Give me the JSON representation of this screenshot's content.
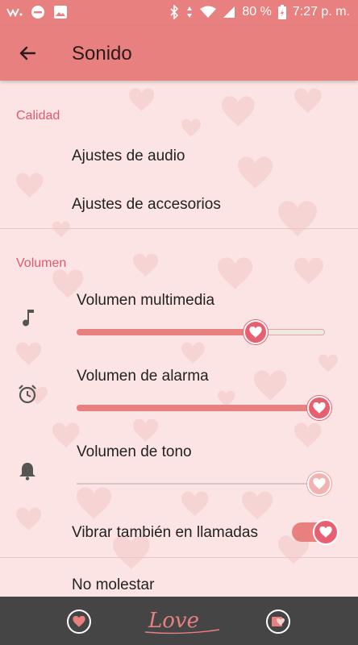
{
  "status_bar": {
    "battery_percent": "80 %",
    "time": "7:27 p. m."
  },
  "app_bar": {
    "title": "Sonido"
  },
  "sections": {
    "calidad": {
      "header": "Calidad",
      "items": [
        "Ajustes de audio",
        "Ajustes de accesorios"
      ]
    },
    "volumen": {
      "header": "Volumen",
      "media_label": "Volumen multimedia",
      "media_level": 0.73,
      "alarm_label": "Volumen de alarma",
      "alarm_level": 1.0,
      "ring_label": "Volumen de tono",
      "ring_level": 1.0
    }
  },
  "vibrate": {
    "label": "Vibrar también en llamadas",
    "enabled": true
  },
  "dnd": {
    "label": "No molestar"
  },
  "bottom_bar": {
    "logo_text": "Love"
  },
  "colors": {
    "accent": "#e88080",
    "section_header": "#e05a6c",
    "background": "#fce4e4",
    "bottom_bar": "#454545"
  }
}
